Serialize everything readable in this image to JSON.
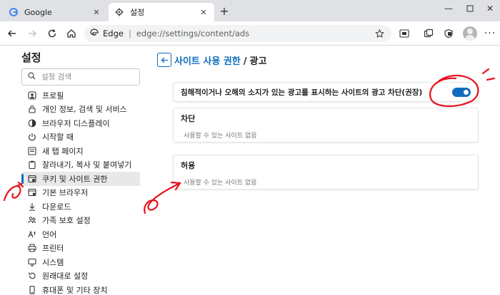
{
  "tabs": [
    {
      "title": "Google",
      "icon": "google-icon"
    },
    {
      "title": "설정",
      "icon": "gear-icon"
    }
  ],
  "address": {
    "site_label": "Edge",
    "url": "edge://settings/content/ads"
  },
  "sidebar": {
    "title": "설정",
    "search_placeholder": "설정 검색",
    "items": [
      {
        "label": "프로필",
        "icon": "profile-icon"
      },
      {
        "label": "개인 정보, 검색 및 서비스",
        "icon": "lock-icon"
      },
      {
        "label": "브라우저 디스플레이",
        "icon": "display-icon"
      },
      {
        "label": "시작할 때",
        "icon": "power-icon"
      },
      {
        "label": "새 탭 페이지",
        "icon": "newtab-page-icon"
      },
      {
        "label": "잘라내기, 복사 및 붙여넣기",
        "icon": "clipboard-icon"
      },
      {
        "label": "쿠키 및 사이트 권한",
        "icon": "site-permissions-icon"
      },
      {
        "label": "기본 브라우저",
        "icon": "default-browser-icon"
      },
      {
        "label": "다운로드",
        "icon": "download-icon"
      },
      {
        "label": "가족 보호 설정",
        "icon": "family-icon"
      },
      {
        "label": "언어",
        "icon": "language-icon"
      },
      {
        "label": "프린터",
        "icon": "printer-icon"
      },
      {
        "label": "시스템",
        "icon": "system-icon"
      },
      {
        "label": "원래대로 설정",
        "icon": "reset-icon"
      },
      {
        "label": "휴대폰 및 기타 장치",
        "icon": "phone-icon"
      }
    ],
    "active_index": 6
  },
  "main": {
    "breadcrumb_parent": "사이트 사용 권한",
    "breadcrumb_separator": "/",
    "breadcrumb_current": "광고",
    "toggle_label": "침해적이거나 오해의 소지가 있는 광고를 표시하는 사이트의 광고 차단(권장)",
    "toggle_on": true,
    "block_title": "차단",
    "block_empty": "사용할 수 있는 사이트 없음",
    "allow_title": "허용",
    "allow_empty": "사용할 수 있는 사이트 없음"
  },
  "colors": {
    "accent": "#0f6cbd",
    "annotation": "#e8121d",
    "tabstrip": "#dfe1e5"
  }
}
